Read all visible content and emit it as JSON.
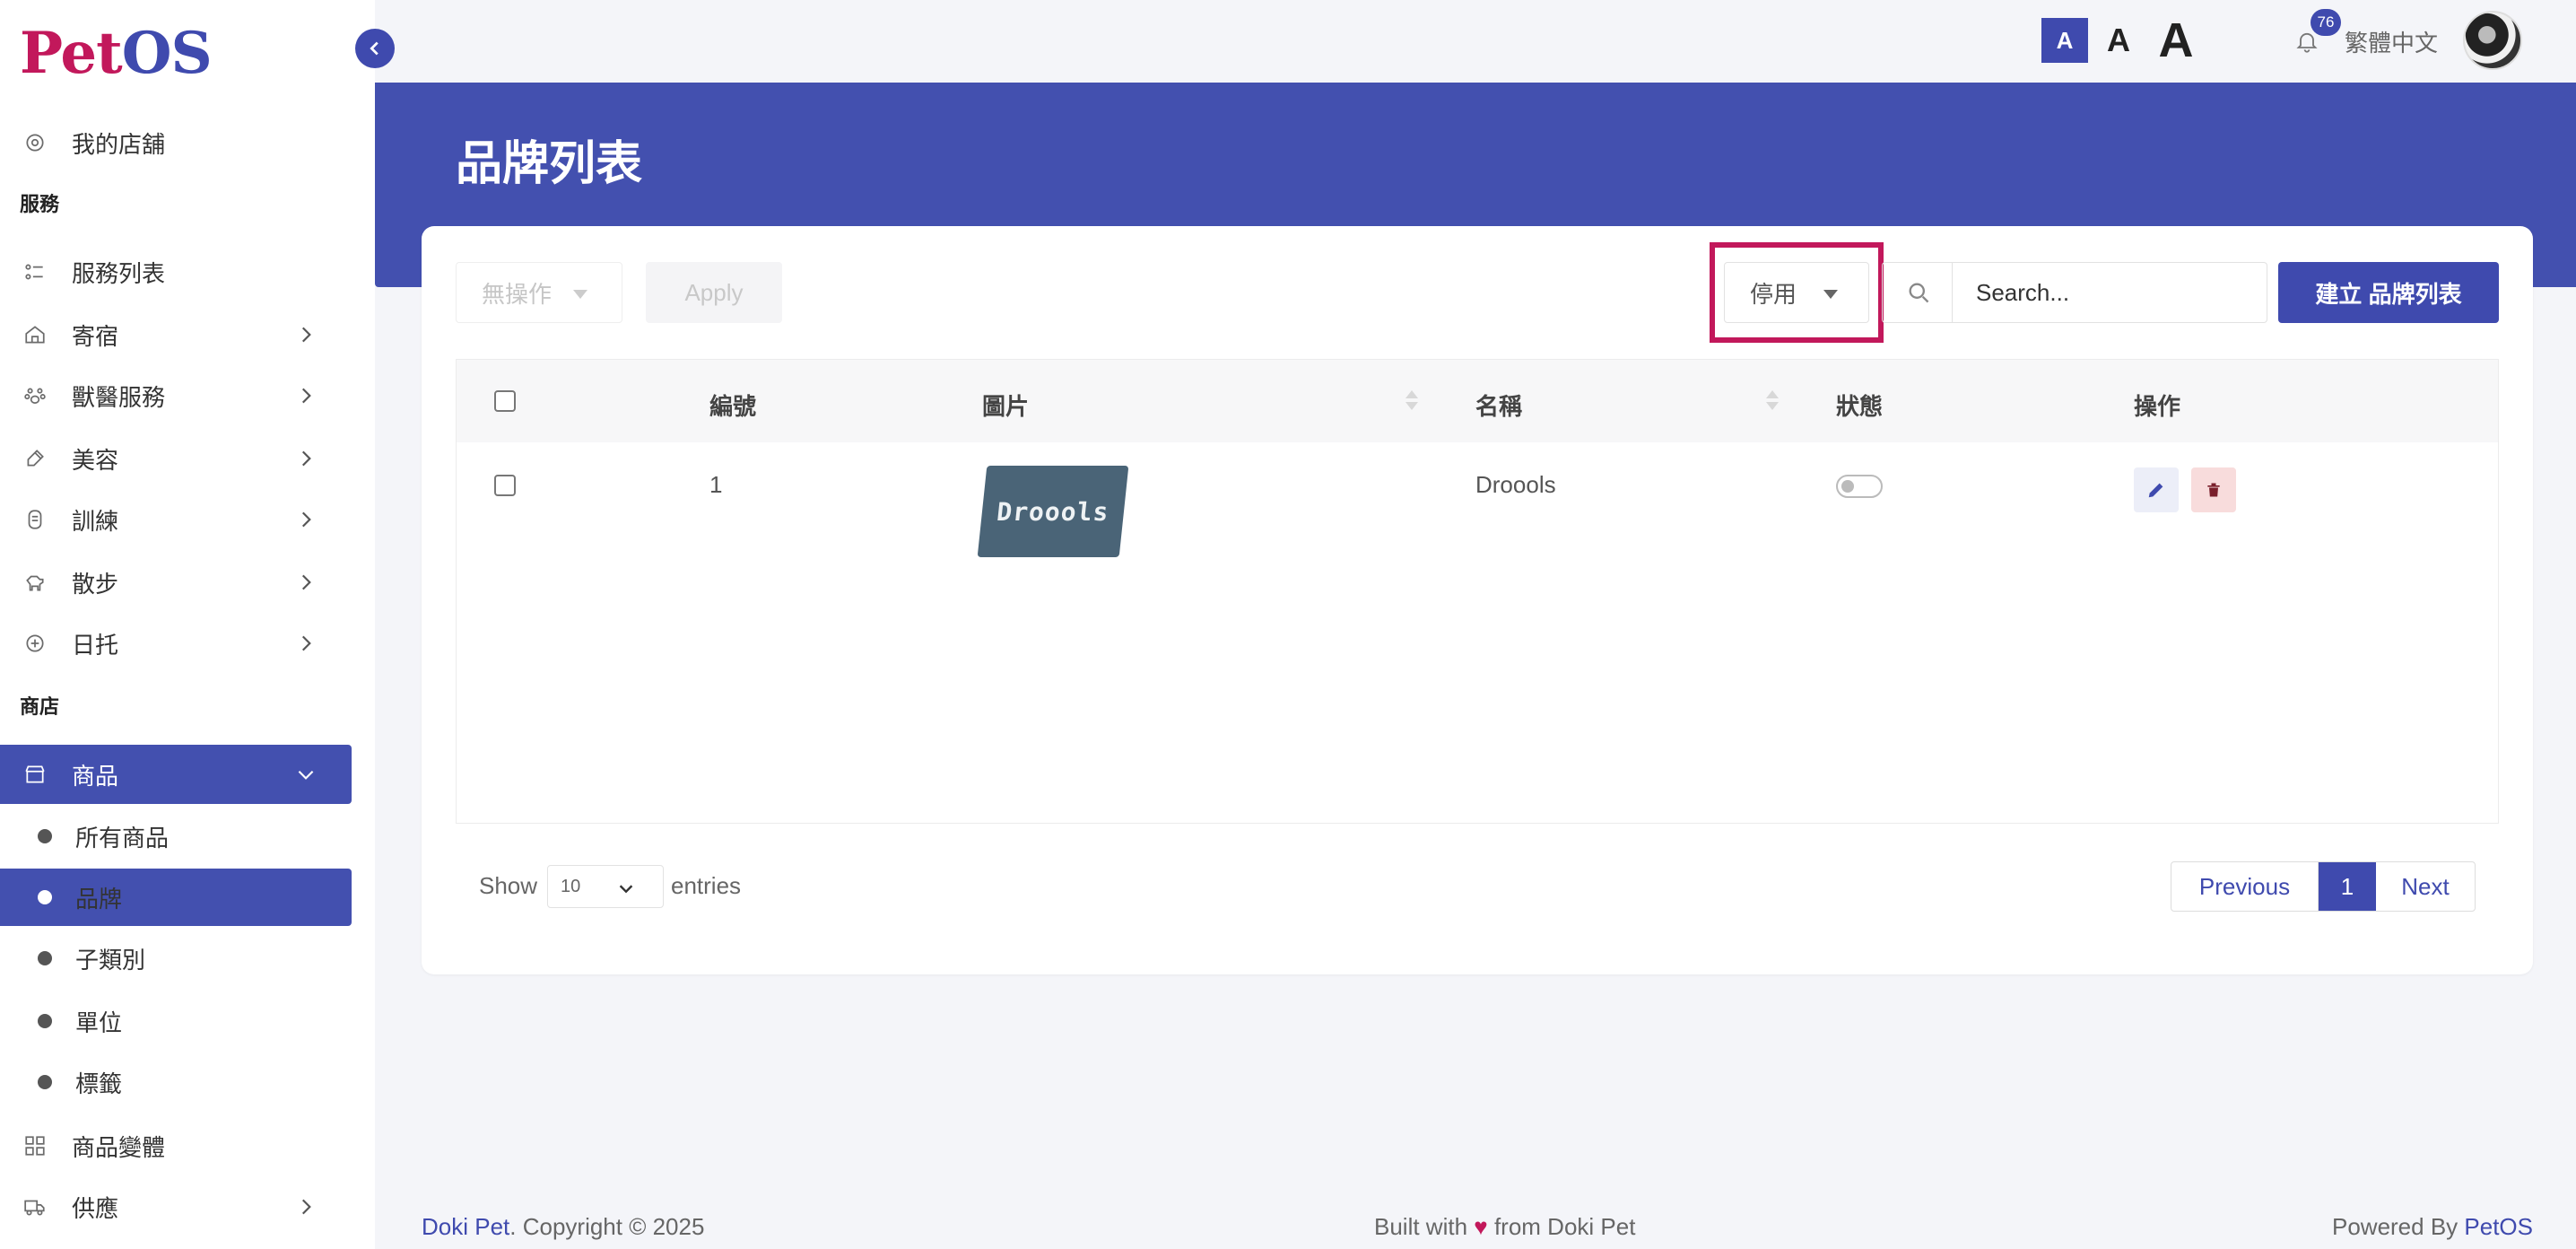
{
  "app": {
    "logo_pet": "Pet",
    "logo_os": "OS"
  },
  "topbar": {
    "font_small": "A",
    "font_medium": "A",
    "font_large": "A",
    "notification_count": "76",
    "language": "繁體中文"
  },
  "sidebar": {
    "my_store": "我的店舖",
    "section_service": "服務",
    "service_list": "服務列表",
    "boarding": "寄宿",
    "vet": "獸醫服務",
    "grooming": "美容",
    "training": "訓練",
    "walking": "散步",
    "daycare": "日托",
    "section_store": "商店",
    "products": "商品",
    "all_products": "所有商品",
    "brands": "品牌",
    "subcategory": "子類別",
    "unit": "單位",
    "tags": "標籤",
    "variants": "商品變體",
    "supply": "供應"
  },
  "page": {
    "title": "品牌列表"
  },
  "toolbar": {
    "bulk_action": "無操作",
    "apply": "Apply",
    "status_filter": "停用",
    "search_placeholder": "Search...",
    "create_button": "建立 品牌列表"
  },
  "table": {
    "headers": {
      "id": "編號",
      "image": "圖片",
      "name": "名稱",
      "status": "狀態",
      "actions": "操作"
    },
    "rows": [
      {
        "id": "1",
        "image_text": "Droools",
        "name": "Droools",
        "status_on": false
      }
    ]
  },
  "pagination": {
    "show": "Show",
    "entries_value": "10",
    "entries": "entries",
    "previous": "Previous",
    "current_page": "1",
    "next": "Next"
  },
  "footer": {
    "brand": "Doki Pet",
    "copyright": ". Copyright © 2025",
    "built_prefix": "Built with",
    "built_suffix": "from Doki Pet",
    "powered_prefix": "Powered By",
    "powered_brand": "PetOS"
  },
  "colors": {
    "primary": "#3f4aae",
    "accent": "#c2185b",
    "background": "#f4f5f9"
  }
}
